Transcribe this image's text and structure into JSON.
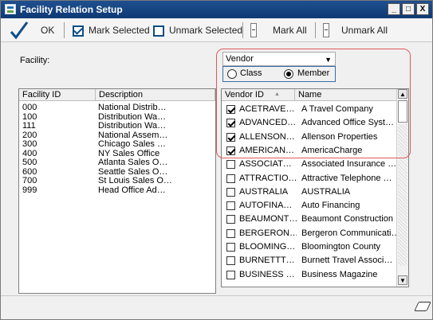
{
  "window": {
    "title": "Facility Relation Setup",
    "min_label": "_",
    "max_label": "□",
    "close_label": "X"
  },
  "toolbar": {
    "ok_label": "OK",
    "mark_selected_label": "Mark Selected",
    "unmark_selected_label": "Unmark Selected",
    "mark_all_label": "Mark All",
    "unmark_all_label": "Unmark All"
  },
  "facility_label": "Facility:",
  "type_select": {
    "value": "Vendor"
  },
  "radio": {
    "class_label": "Class",
    "member_label": "Member",
    "selected": "Member"
  },
  "facility_grid": {
    "headers": [
      "Facility ID",
      "Description"
    ],
    "rows": [
      [
        "000",
        "National Distrib…"
      ],
      [
        "100",
        "Distribution Wa…"
      ],
      [
        "111",
        "Distribution Wa…"
      ],
      [
        "200",
        "National Assem…"
      ],
      [
        "300",
        "Chicago Sales …"
      ],
      [
        "400",
        "NY Sales Office"
      ],
      [
        "500",
        "Atlanta Sales O…"
      ],
      [
        "600",
        "Seattle Sales O…"
      ],
      [
        "700",
        "St Louis Sales O…"
      ],
      [
        "999",
        "Head Office Ad…"
      ]
    ]
  },
  "vendor_grid": {
    "headers": [
      "Vendor ID",
      "Name"
    ],
    "sort_indicator": "▲",
    "rows": [
      {
        "checked": true,
        "id": "ACETRAVE…",
        "name": "A Travel Company"
      },
      {
        "checked": true,
        "id": "ADVANCED…",
        "name": "Advanced Office Syst…"
      },
      {
        "checked": true,
        "id": "ALLENSON…",
        "name": "Allenson Properties"
      },
      {
        "checked": true,
        "id": "AMERICAN…",
        "name": "AmericaCharge"
      },
      {
        "checked": false,
        "id": "ASSOCIAT…",
        "name": "Associated Insurance …"
      },
      {
        "checked": false,
        "id": "ATTRACTIO…",
        "name": "Attractive Telephone …"
      },
      {
        "checked": false,
        "id": "AUSTRALIA",
        "name": "AUSTRALIA"
      },
      {
        "checked": false,
        "id": "AUTOFINA…",
        "name": "Auto Financing"
      },
      {
        "checked": false,
        "id": "BEAUMONT…",
        "name": "Beaumont Construction"
      },
      {
        "checked": false,
        "id": "BERGERON…",
        "name": "Bergeron Communicati…"
      },
      {
        "checked": false,
        "id": "BLOOMING…",
        "name": "Bloomington County"
      },
      {
        "checked": false,
        "id": "BURNETTT…",
        "name": "Burnett Travel Associ…"
      },
      {
        "checked": false,
        "id": "BUSINESS …",
        "name": "Business Magazine"
      }
    ]
  },
  "colors": {
    "titlebar": "#0e3a74",
    "highlight_ring": "#e05a5a",
    "accent_blue": "#0f4d86"
  },
  "icons": [
    "app-icon",
    "checkmark-icon",
    "mark-selected-icon",
    "unmark-selected-icon",
    "mark-all-icon",
    "unmark-all-icon",
    "eraser-icon"
  ]
}
